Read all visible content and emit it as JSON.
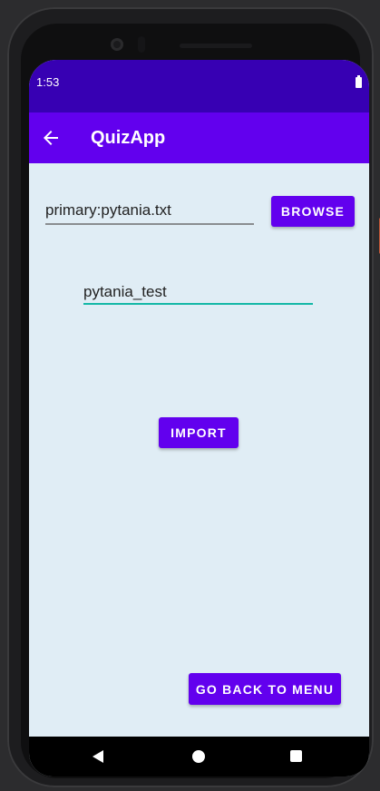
{
  "status_bar": {
    "time": "1:53"
  },
  "app_bar": {
    "title": "QuizApp",
    "back_icon": "arrow-left-icon"
  },
  "file": {
    "path_value": "primary:pytania.txt",
    "browse_label": "BROWSE"
  },
  "name_input": {
    "value": "pytania_test"
  },
  "import": {
    "label": "IMPORT"
  },
  "menu": {
    "go_back_label": "GO BACK TO MENU"
  },
  "nav_bar": {
    "back_icon": "nav-back-icon",
    "home_icon": "nav-home-icon",
    "recents_icon": "nav-recents-icon"
  },
  "colors": {
    "primary": "#6200ee",
    "status": "#3700b3",
    "background": "#e0edf5",
    "accent": "#14b8a6"
  }
}
